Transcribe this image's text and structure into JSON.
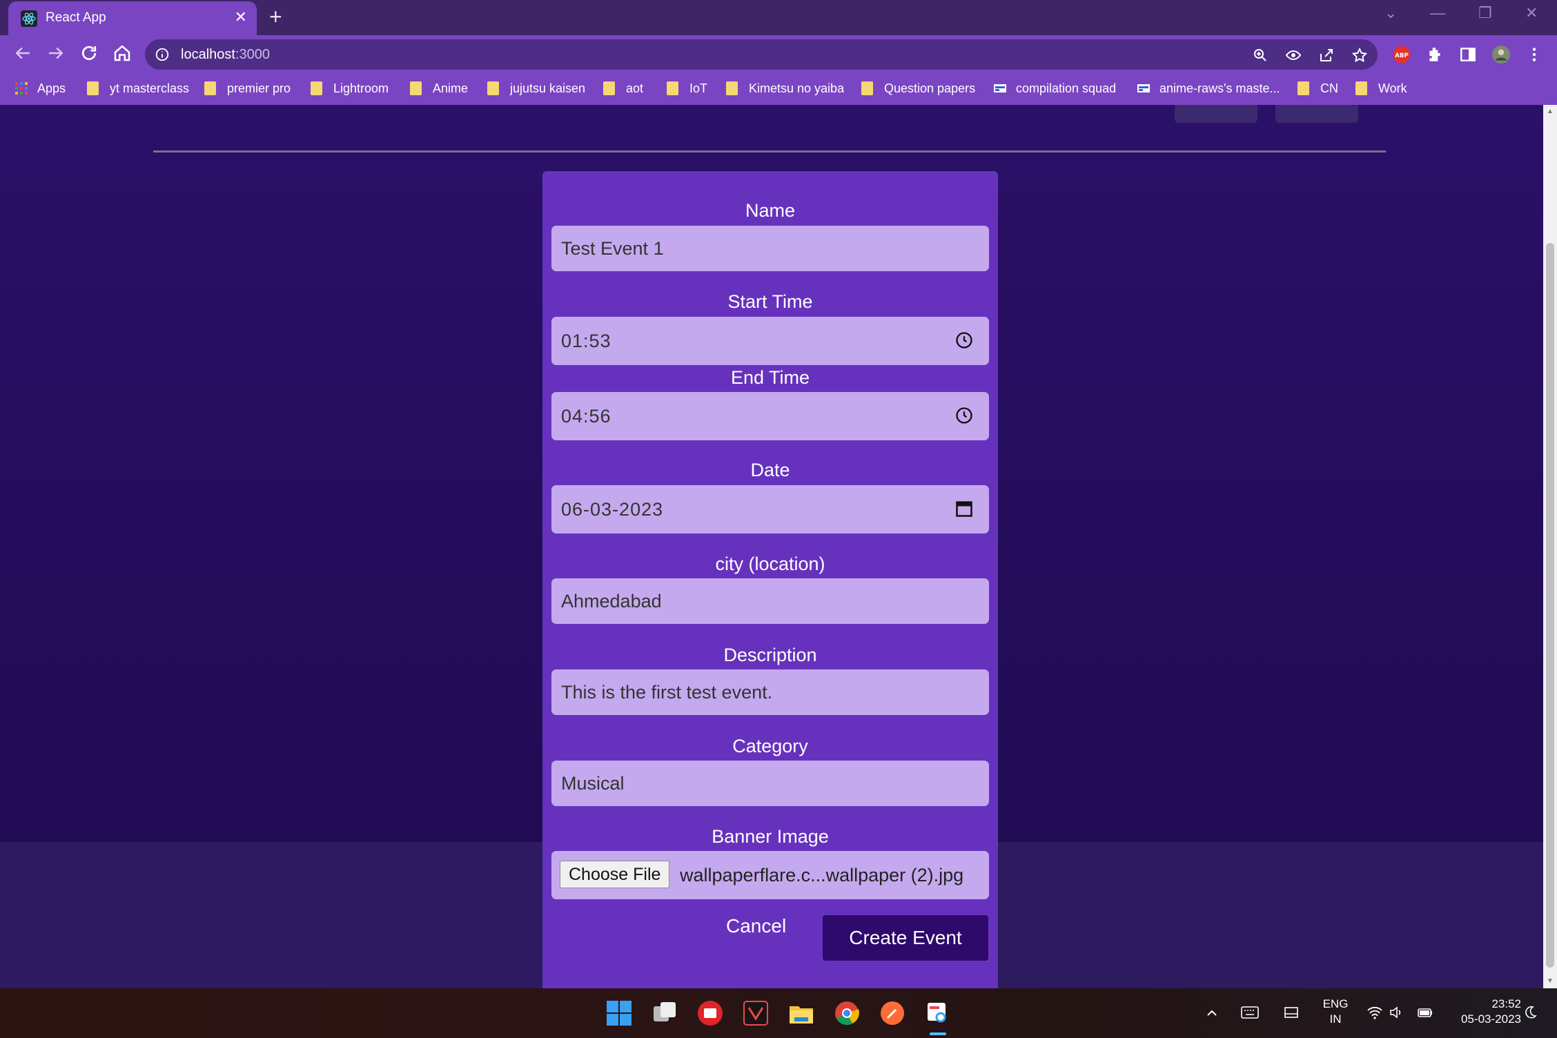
{
  "browser": {
    "tab_title": "React App",
    "new_tab_label": "+",
    "url_host": "localhost",
    "url_port": ":3000",
    "bookmarks": [
      "Apps",
      "yt masterclass",
      "premier pro",
      "Lightroom",
      "Anime",
      "jujutsu kaisen",
      "aot",
      "IoT",
      "Kimetsu no yaiba",
      "Question papers",
      "compilation squad",
      "anime-raws's maste...",
      "CN",
      "Work"
    ],
    "extension_badge": "ABP"
  },
  "form": {
    "name": {
      "label": "Name",
      "value": "Test Event 1"
    },
    "start_time": {
      "label": "Start Time",
      "value": "01:53"
    },
    "end_time": {
      "label": "End Time",
      "value": "04:56"
    },
    "date": {
      "label": "Date",
      "value": "06-03-2023"
    },
    "city": {
      "label": "city (location)",
      "value": "Ahmedabad"
    },
    "description": {
      "label": "Description",
      "value": "This is the first test event."
    },
    "category": {
      "label": "Category",
      "value": "Musical"
    },
    "banner": {
      "label": "Banner Image",
      "button": "Choose File",
      "filename": "wallpaperflare.c...wallpaper (2).jpg"
    },
    "cancel_label": "Cancel",
    "submit_label": "Create Event"
  },
  "taskbar": {
    "lang_top": "ENG",
    "lang_bottom": "IN",
    "time": "23:52",
    "date": "05-03-2023"
  },
  "colors": {
    "accent": "#7a45c3",
    "card": "#6632bd",
    "field": "#c5a9ee",
    "submit": "#2d0a6c"
  }
}
